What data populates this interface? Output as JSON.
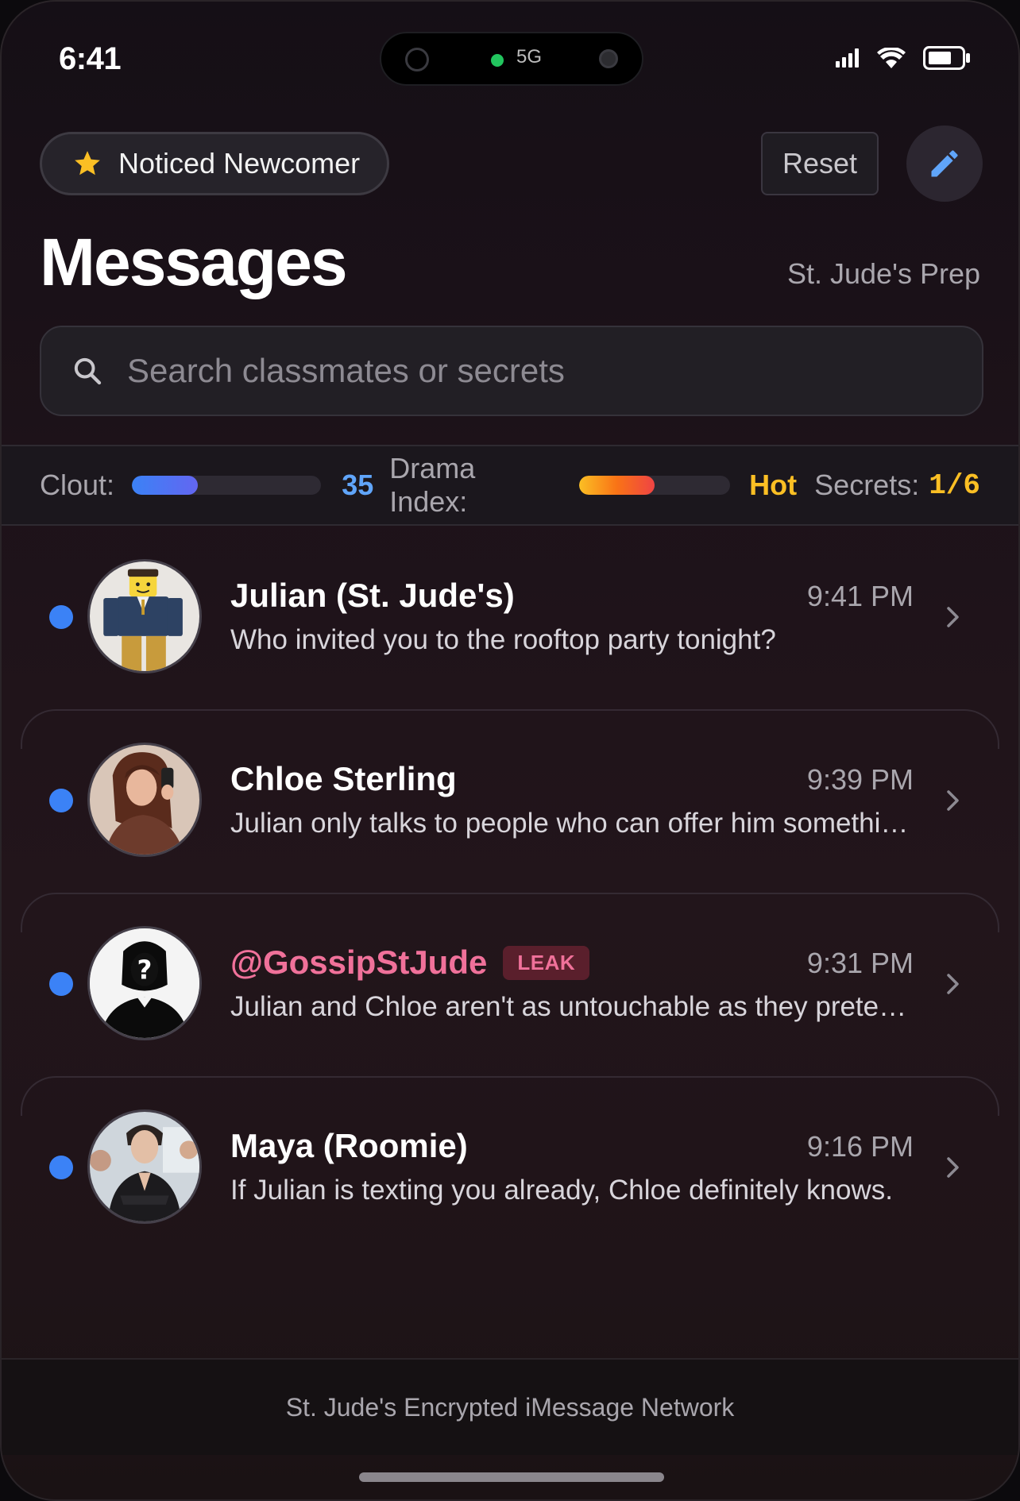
{
  "status_bar": {
    "time": "6:41",
    "network": "5G",
    "battery_level": 0.7
  },
  "header": {
    "badge_label": "Noticed Newcomer",
    "reset_label": "Reset",
    "title": "Messages",
    "school": "St. Jude's Prep"
  },
  "search": {
    "placeholder": "Search classmates or secrets",
    "value": ""
  },
  "stats": {
    "clout_label": "Clout:",
    "clout_value": "35",
    "clout_fraction": 0.35,
    "drama_label": "Drama Index:",
    "drama_value": "Hot",
    "drama_fraction": 0.5,
    "secrets_label": "Secrets:",
    "secrets_value": "1/6"
  },
  "messages": [
    {
      "name": "Julian (St. Jude's)",
      "time": "9:41 PM",
      "preview": "Who invited you to the rooftop party tonight?",
      "unread": true,
      "avatar": "blazer-avatar"
    },
    {
      "name": "Chloe Sterling",
      "time": "9:39 PM",
      "preview": "Julian only talks to people who can offer him something real.",
      "unread": true,
      "avatar": "selfie-avatar"
    },
    {
      "name": "@GossipStJude",
      "tag": "LEAK",
      "time": "9:31 PM",
      "preview": "Julian and Chloe aren't as untouchable as they pretend to be.",
      "unread": true,
      "avatar": "anonymous-avatar"
    },
    {
      "name": "Maya (Roomie)",
      "time": "9:16 PM",
      "preview": "If Julian is texting you already, Chloe definitely knows.",
      "unread": true,
      "avatar": "group-avatar"
    }
  ],
  "footer": {
    "text": "St. Jude's Encrypted iMessage Network"
  },
  "colors": {
    "accent_blue": "#3b82f6",
    "hot": "#fbbf24",
    "gossip": "#f0719a"
  }
}
